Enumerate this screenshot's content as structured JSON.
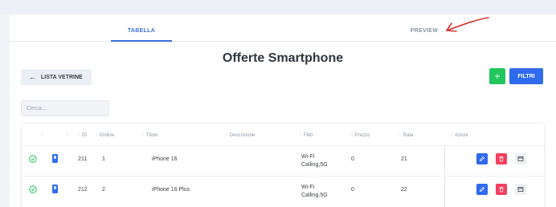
{
  "tabs": {
    "table": "TABELLA",
    "preview": "PREVIEW"
  },
  "page": {
    "title": "Offerte Smartphone"
  },
  "toolbar": {
    "back_label": "LISTA VETRINE",
    "add_label": "+",
    "filter_label": "FILTRI"
  },
  "search": {
    "placeholder": "Cerca..."
  },
  "table": {
    "columns": [
      "",
      "",
      "ID",
      "Ordine",
      "Titolo",
      "Descrizione",
      "Filtri",
      "Prezzo",
      "Rata",
      "Azioni"
    ],
    "rows": [
      {
        "id": "211",
        "ordine": "1",
        "titolo": "iPhone 16",
        "descrizione": "",
        "filtri_line1": "Wi-Fi",
        "filtri_line2": "Calling,5G",
        "prezzo": "0",
        "rata": "21"
      },
      {
        "id": "212",
        "ordine": "2",
        "titolo": "iPhone 16 Plus",
        "descrizione": "",
        "filtri_line1": "Wi-Fi",
        "filtri_line2": "Calling,5G",
        "prezzo": "0",
        "rata": "22"
      }
    ]
  },
  "colors": {
    "accent": "#2f6bed",
    "success": "#22c55e",
    "danger": "#f43f5e",
    "annotation": "#e03131"
  }
}
